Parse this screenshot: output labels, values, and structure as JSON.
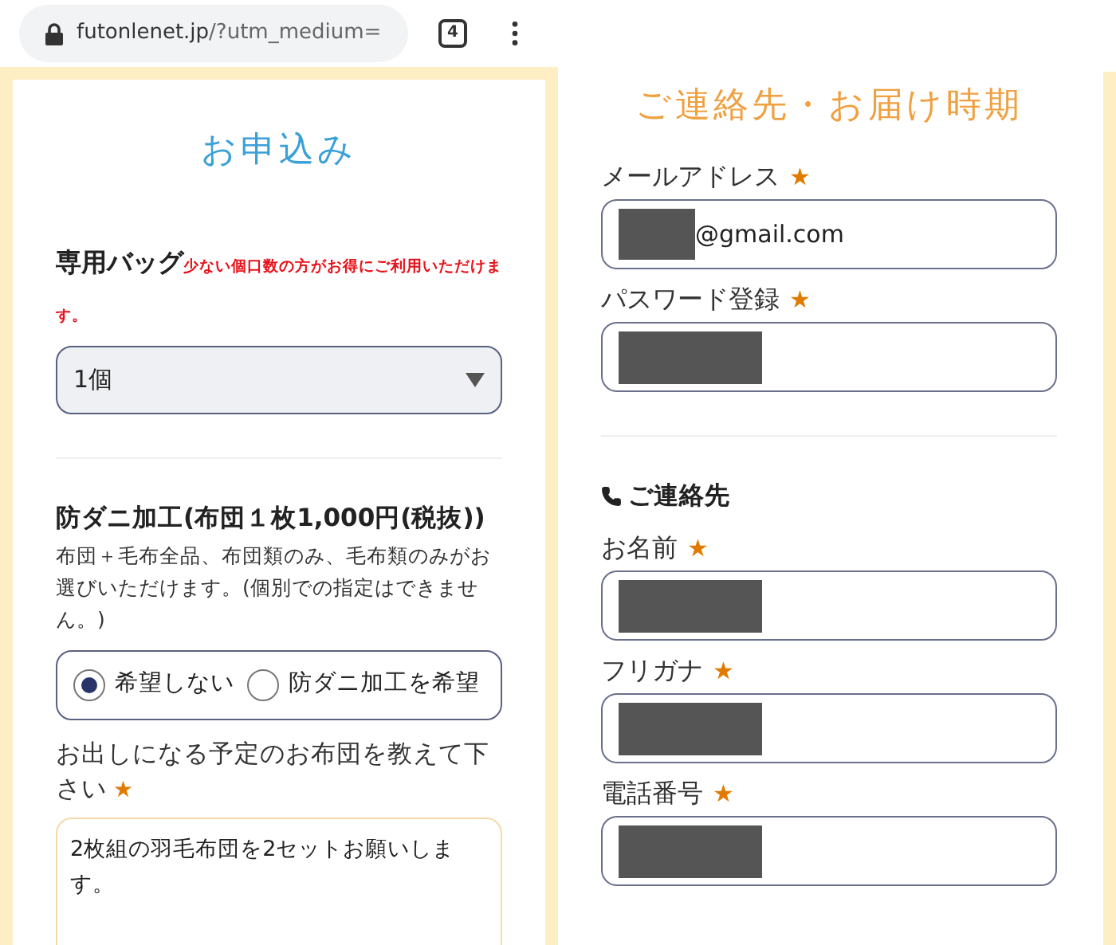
{
  "browser": {
    "url_host": "futonlenet.jp",
    "url_rest": "/?utm_medium=",
    "tab_count": "4"
  },
  "order": {
    "title": "お申込み",
    "bag": {
      "label": "専用バッグ",
      "note": "少ない個口数の方がお得にご利用いただけます。",
      "value": "1個"
    },
    "mite": {
      "heading": "防ダニ加工(布団１枚1,000円(税抜))",
      "description": "布団＋毛布全品、布団類のみ、毛布類のみがお選びいただけます。(個別での指定はできません。)",
      "options": [
        {
          "label": "希望しない",
          "selected": true
        },
        {
          "label": "防ダニ加工を希望",
          "selected": false
        }
      ]
    },
    "question": {
      "label": "お出しになる予定のお布団を教えて下さい",
      "required_mark": "★",
      "value": "2枚組の羽毛布団を2セットお願いします。"
    }
  },
  "contact": {
    "title": "ご連絡先・お届け時期",
    "account_fields": [
      {
        "label": "メールアドレス",
        "required_mark": "★",
        "redacted": true,
        "value": "@gmail.com"
      },
      {
        "label": "パスワード登録",
        "required_mark": "★",
        "redacted": true
      }
    ],
    "section_heading": "ご連絡先",
    "contact_fields": [
      {
        "label": "お名前",
        "required_mark": "★",
        "redacted": true
      },
      {
        "label": "フリガナ",
        "required_mark": "★",
        "redacted": true
      },
      {
        "label": "電話番号",
        "required_mark": "★",
        "redacted": true
      }
    ]
  }
}
